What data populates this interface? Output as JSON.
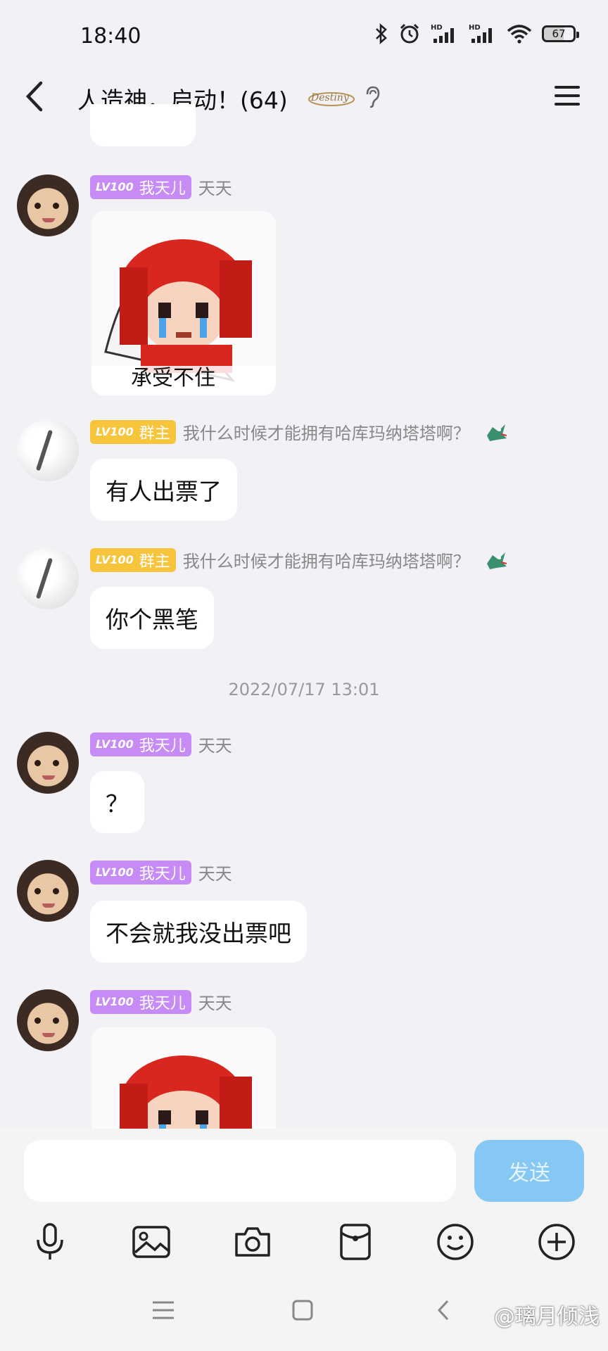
{
  "status_bar": {
    "time": "18:40",
    "signal_labels": [
      "HD",
      "HD"
    ],
    "battery_level": "67"
  },
  "header": {
    "title": "人造神，启动！(64)",
    "badge_text": "Destiny"
  },
  "messages": [
    {
      "sender_level": "LV100",
      "sender_title": "我天儿",
      "sender_name": "天天",
      "type": "sticker",
      "sticker_caption": "承受不住"
    },
    {
      "sender_level": "LV100",
      "sender_title": "群主",
      "sender_name": "我什么时候才能拥有哈库玛纳塔塔啊？",
      "type": "text",
      "text": "有人出票了"
    },
    {
      "sender_level": "LV100",
      "sender_title": "群主",
      "sender_name": "我什么时候才能拥有哈库玛纳塔塔啊？",
      "type": "text",
      "text": "你个黑笔"
    },
    {
      "sender_level": "LV100",
      "sender_title": "我天儿",
      "sender_name": "天天",
      "type": "text",
      "text": "？"
    },
    {
      "sender_level": "LV100",
      "sender_title": "我天儿",
      "sender_name": "天天",
      "type": "text",
      "text": "不会就我没出票吧"
    },
    {
      "sender_level": "LV100",
      "sender_title": "我天儿",
      "sender_name": "天天",
      "type": "sticker"
    }
  ],
  "timestamp": "2022/07/17 13:01",
  "input": {
    "placeholder": "",
    "send_label": "发送"
  },
  "toolbar": [
    "microphone-icon",
    "image-icon",
    "camera-icon",
    "red-packet-icon",
    "emoji-icon",
    "plus-icon"
  ],
  "watermark": "@璃月倾浅",
  "colors": {
    "background": "#f2f1f6",
    "badge_purple": "#c78bf5",
    "badge_gold": "#f6c53b",
    "send_button": "#85c8f3"
  }
}
